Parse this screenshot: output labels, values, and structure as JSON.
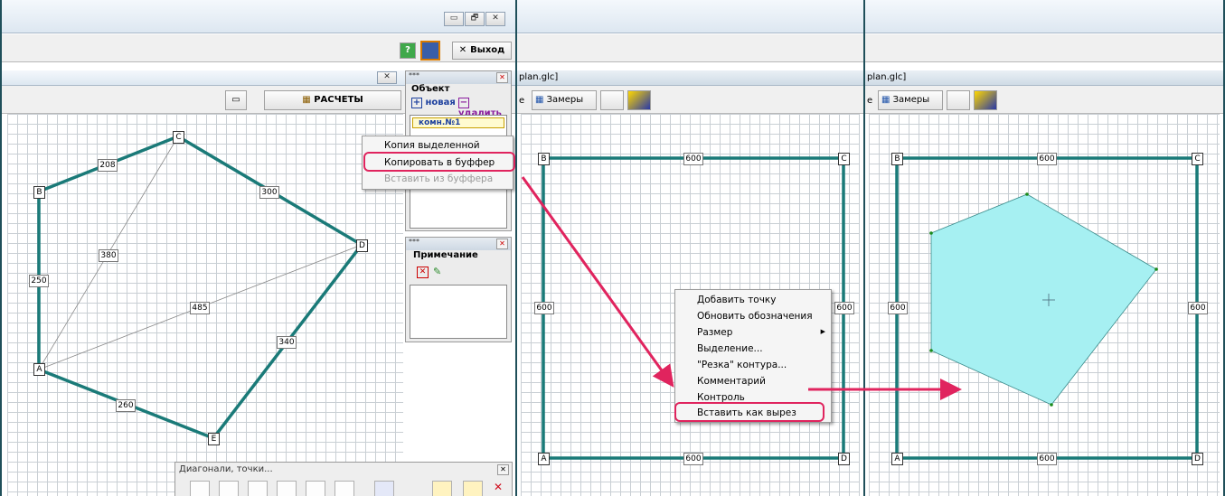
{
  "panel1": {
    "title_right_buttons": [
      "▭",
      "🗗",
      "✕"
    ],
    "toolbar_exit": "Выход",
    "window_close": "✕",
    "calc_button": "РАСЧЕТЫ",
    "side_object": {
      "header": "***",
      "title": "Объект",
      "new_label": "новая",
      "delete_label": "удалить",
      "room_label": "комн.№1"
    },
    "side_note": {
      "header": "***",
      "title": "Примечание"
    },
    "context_menu": {
      "items": [
        "Копия выделенной",
        "Копировать в буффер",
        "Вставить из буффера"
      ]
    },
    "bottom_panel": {
      "title": "Диагонали, точки..."
    },
    "vertices": [
      "A",
      "B",
      "C",
      "D",
      "E"
    ],
    "edge_labels": [
      "208",
      "300",
      "250",
      "380",
      "485",
      "340",
      "260"
    ]
  },
  "panel2": {
    "path_tab": "plan.glc]",
    "toolbar": {
      "measure_label": "Замеры",
      "lead": "e"
    },
    "vertices": [
      "B",
      "C",
      "A",
      "D"
    ],
    "edge_labels": [
      "600",
      "600",
      "600",
      "600"
    ],
    "context_menu": {
      "items": [
        "Добавить точку",
        "Обновить обозначения",
        "Размер",
        "Выделение...",
        "\"Резка\" контура...",
        "Комментарий",
        "Контроль",
        "Вставить как вырез"
      ]
    }
  },
  "panel3": {
    "path_tab": "plan.glc]",
    "toolbar": {
      "measure_label": "Замеры",
      "lead": "e"
    },
    "vertices": [
      "B",
      "C",
      "A",
      "D"
    ],
    "edge_labels": [
      "600",
      "600",
      "600",
      "600"
    ]
  },
  "colors": {
    "contour": "#1a7a78",
    "accent_arrow": "#e0245e",
    "cutout_fill": "#a6f0f2"
  }
}
